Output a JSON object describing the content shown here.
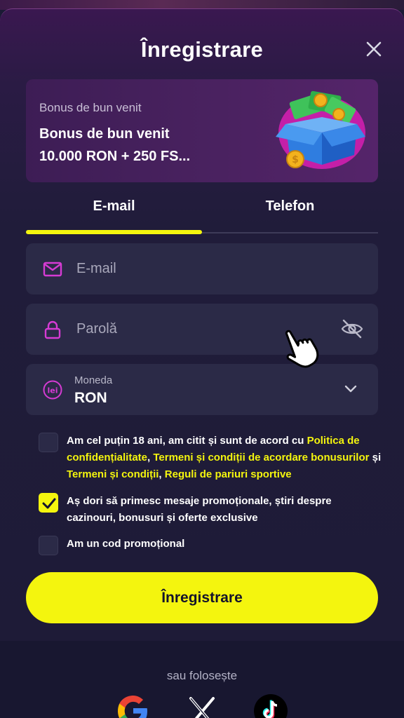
{
  "header": {
    "title": "Înregistrare"
  },
  "bonus": {
    "subtitle": "Bonus de bun venit",
    "title_line1": "Bonus de bun venit",
    "title_line2": "10.000 RON + 250 FS..."
  },
  "tabs": [
    {
      "label": "E-mail",
      "active": true
    },
    {
      "label": "Telefon",
      "active": false
    }
  ],
  "form": {
    "email": {
      "placeholder": "E-mail",
      "icon": "mail-icon"
    },
    "password": {
      "placeholder": "Parolă",
      "icon": "lock-icon",
      "toggle_icon": "eye-off-icon"
    },
    "currency": {
      "label": "Moneda",
      "value": "RON",
      "icon_text": "lei"
    }
  },
  "consents": {
    "age": {
      "checked": false,
      "text1": "Am cel puțin 18 ani, am citit și sunt de acord cu ",
      "link1": "Politica de confidențialitate",
      "sep1": ", ",
      "link2": "Termeni și condiții de acordare bonusurilor",
      "sep2": " și ",
      "link3": "Termeni și condiții",
      "sep3": ", ",
      "link4": "Reguli de pariuri sportive"
    },
    "promo": {
      "checked": true,
      "text": "Aș dori să primesc mesaje promoționale, știri despre cazinouri, bonusuri și oferte exclusive"
    },
    "code": {
      "checked": false,
      "text": "Am un cod promoțional"
    }
  },
  "submit_label": "Înregistrare",
  "social": {
    "or_label": "sau folosește",
    "providers": [
      "google-icon",
      "x-icon",
      "tiktok-icon"
    ]
  },
  "colors": {
    "accent": "#f4f50e",
    "background": "#1b1a35",
    "field": "#2b2a47",
    "icon": "#d63bd4"
  }
}
